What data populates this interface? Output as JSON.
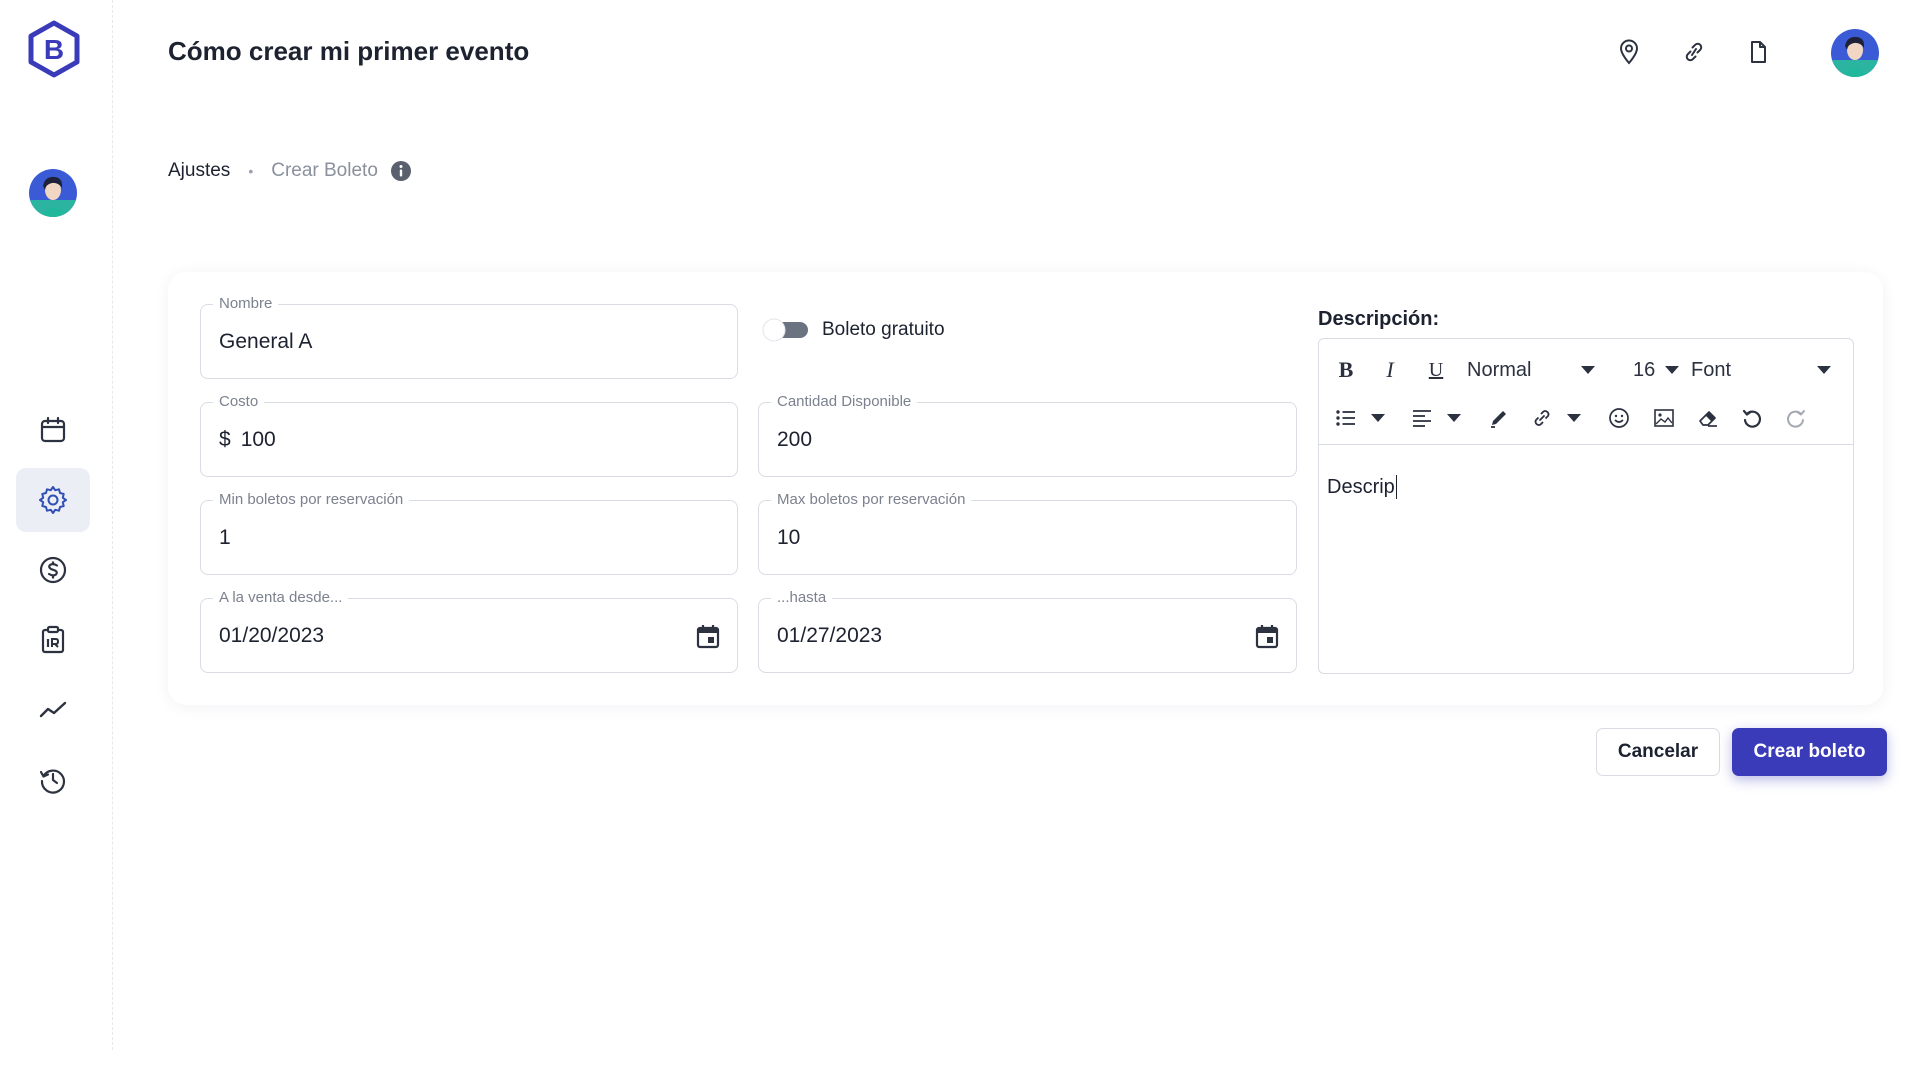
{
  "app": {
    "logo_letter": "B",
    "brand_color": "#3a3bb8",
    "accent_color": "#2f6fd1"
  },
  "header": {
    "title": "Cómo crear mi primer evento",
    "icons": [
      "location-pin-icon",
      "link-icon",
      "document-icon"
    ]
  },
  "sidebar": {
    "items": [
      {
        "icon": "calendar-icon",
        "active": false
      },
      {
        "icon": "settings-gear-icon",
        "active": true
      },
      {
        "icon": "dollar-coin-icon",
        "active": false
      },
      {
        "icon": "reports-icon",
        "active": false
      },
      {
        "icon": "analytics-trend-icon",
        "active": false
      },
      {
        "icon": "history-icon",
        "active": false
      }
    ]
  },
  "breadcrumb": {
    "parent": "Ajustes",
    "separator": "•",
    "current": "Crear Boleto"
  },
  "form": {
    "nombre": {
      "label": "Nombre",
      "value": "General A"
    },
    "boleto_gratuito": {
      "label": "Boleto gratuito",
      "checked": false
    },
    "costo": {
      "label": "Costo",
      "prefix": "$",
      "value": "100"
    },
    "cantidad": {
      "label": "Cantidad Disponible",
      "value": "200"
    },
    "min_boletos": {
      "label": "Min boletos por reservación",
      "value": "1"
    },
    "max_boletos": {
      "label": "Max boletos por reservación",
      "value": "10"
    },
    "venta_desde": {
      "label": "A la venta desde...",
      "value": "01/20/2023"
    },
    "venta_hasta": {
      "label": "...hasta",
      "value": "01/27/2023"
    }
  },
  "description": {
    "title": "Descripción:",
    "toolbar": {
      "block_format": "Normal",
      "font_size": "16",
      "font_family": "Font"
    },
    "content": "Descrip"
  },
  "actions": {
    "cancel_label": "Cancelar",
    "create_label": "Crear boleto"
  }
}
